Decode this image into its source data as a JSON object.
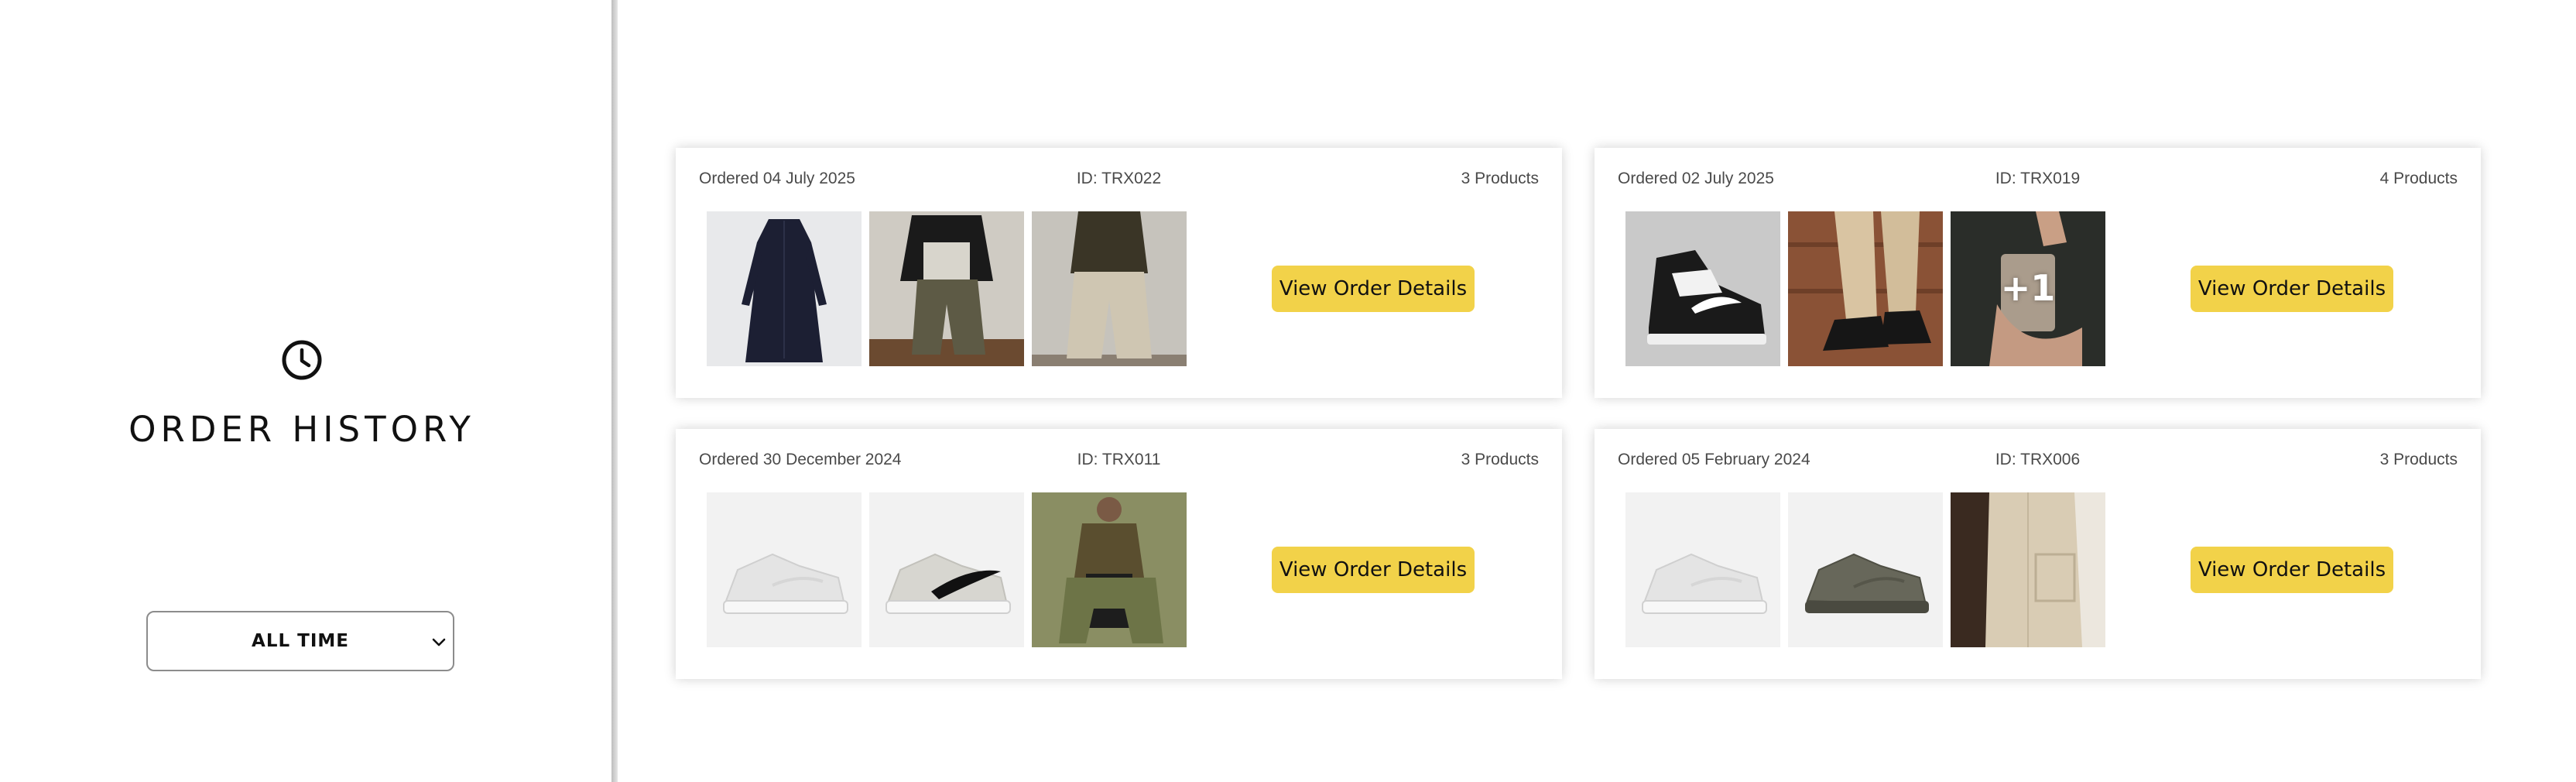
{
  "sidebar": {
    "title": "ORDER HISTORY",
    "icon": "clock-icon",
    "filter": {
      "selected": "ALL TIME"
    }
  },
  "orders": [
    {
      "date": "Ordered 04 July 2025",
      "id": "ID: TRX022",
      "count": "3 Products",
      "button": "View Order Details",
      "extra": ""
    },
    {
      "date": "Ordered 02 July 2025",
      "id": "ID: TRX019",
      "count": "4 Products",
      "button": "View Order Details",
      "extra": "+1"
    },
    {
      "date": "Ordered 30 December 2024",
      "id": "ID: TRX011",
      "count": "3 Products",
      "button": "View Order Details",
      "extra": ""
    },
    {
      "date": "Ordered 05 February 2024",
      "id": "ID: TRX006",
      "count": "3 Products",
      "button": "View Order Details",
      "extra": ""
    }
  ],
  "colors": {
    "accent": "#f2d249",
    "text": "#111111",
    "meta": "#4a4a4a"
  }
}
